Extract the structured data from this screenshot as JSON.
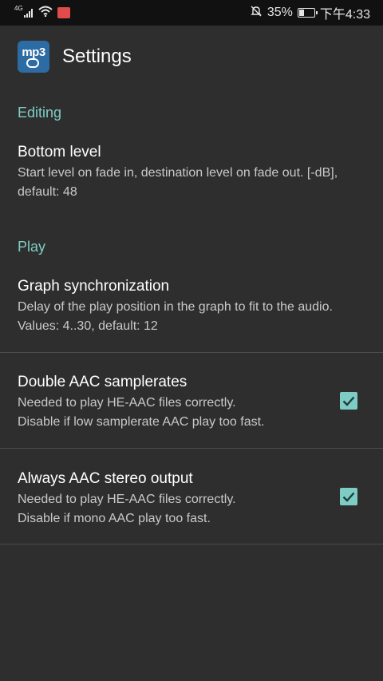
{
  "status_bar": {
    "network_label": "4G",
    "battery_percent": "35%",
    "time": "下午4:33",
    "icons": [
      "signal-icon",
      "wifi-icon",
      "notification-icon",
      "mute-icon",
      "battery-icon"
    ]
  },
  "app_bar": {
    "title": "Settings",
    "icon_text": "mp3"
  },
  "categories": {
    "editing": "Editing",
    "play": "Play"
  },
  "prefs": {
    "bottom_level": {
      "title": "Bottom level",
      "summary": "Start level on fade in, destination level on fade out. [-dB], default: 48"
    },
    "graph_sync": {
      "title": "Graph synchronization",
      "summary": "Delay of the play position in the graph to fit to the audio. Values: 4..30, default: 12"
    },
    "double_aac": {
      "title": "Double AAC samplerates",
      "summary_line1": "Needed to play HE-AAC files correctly.",
      "summary_line2": "Disable if low samplerate AAC play too fast.",
      "checked": true
    },
    "aac_stereo": {
      "title": "Always AAC stereo output",
      "summary_line1": "Needed to play HE-AAC files correctly.",
      "summary_line2": "Disable if mono AAC play too fast.",
      "checked": true
    }
  },
  "colors": {
    "accent": "#7ecdc4",
    "background": "#2e2e2e",
    "status_bar": "#111111",
    "app_icon": "#2c6ba3"
  }
}
